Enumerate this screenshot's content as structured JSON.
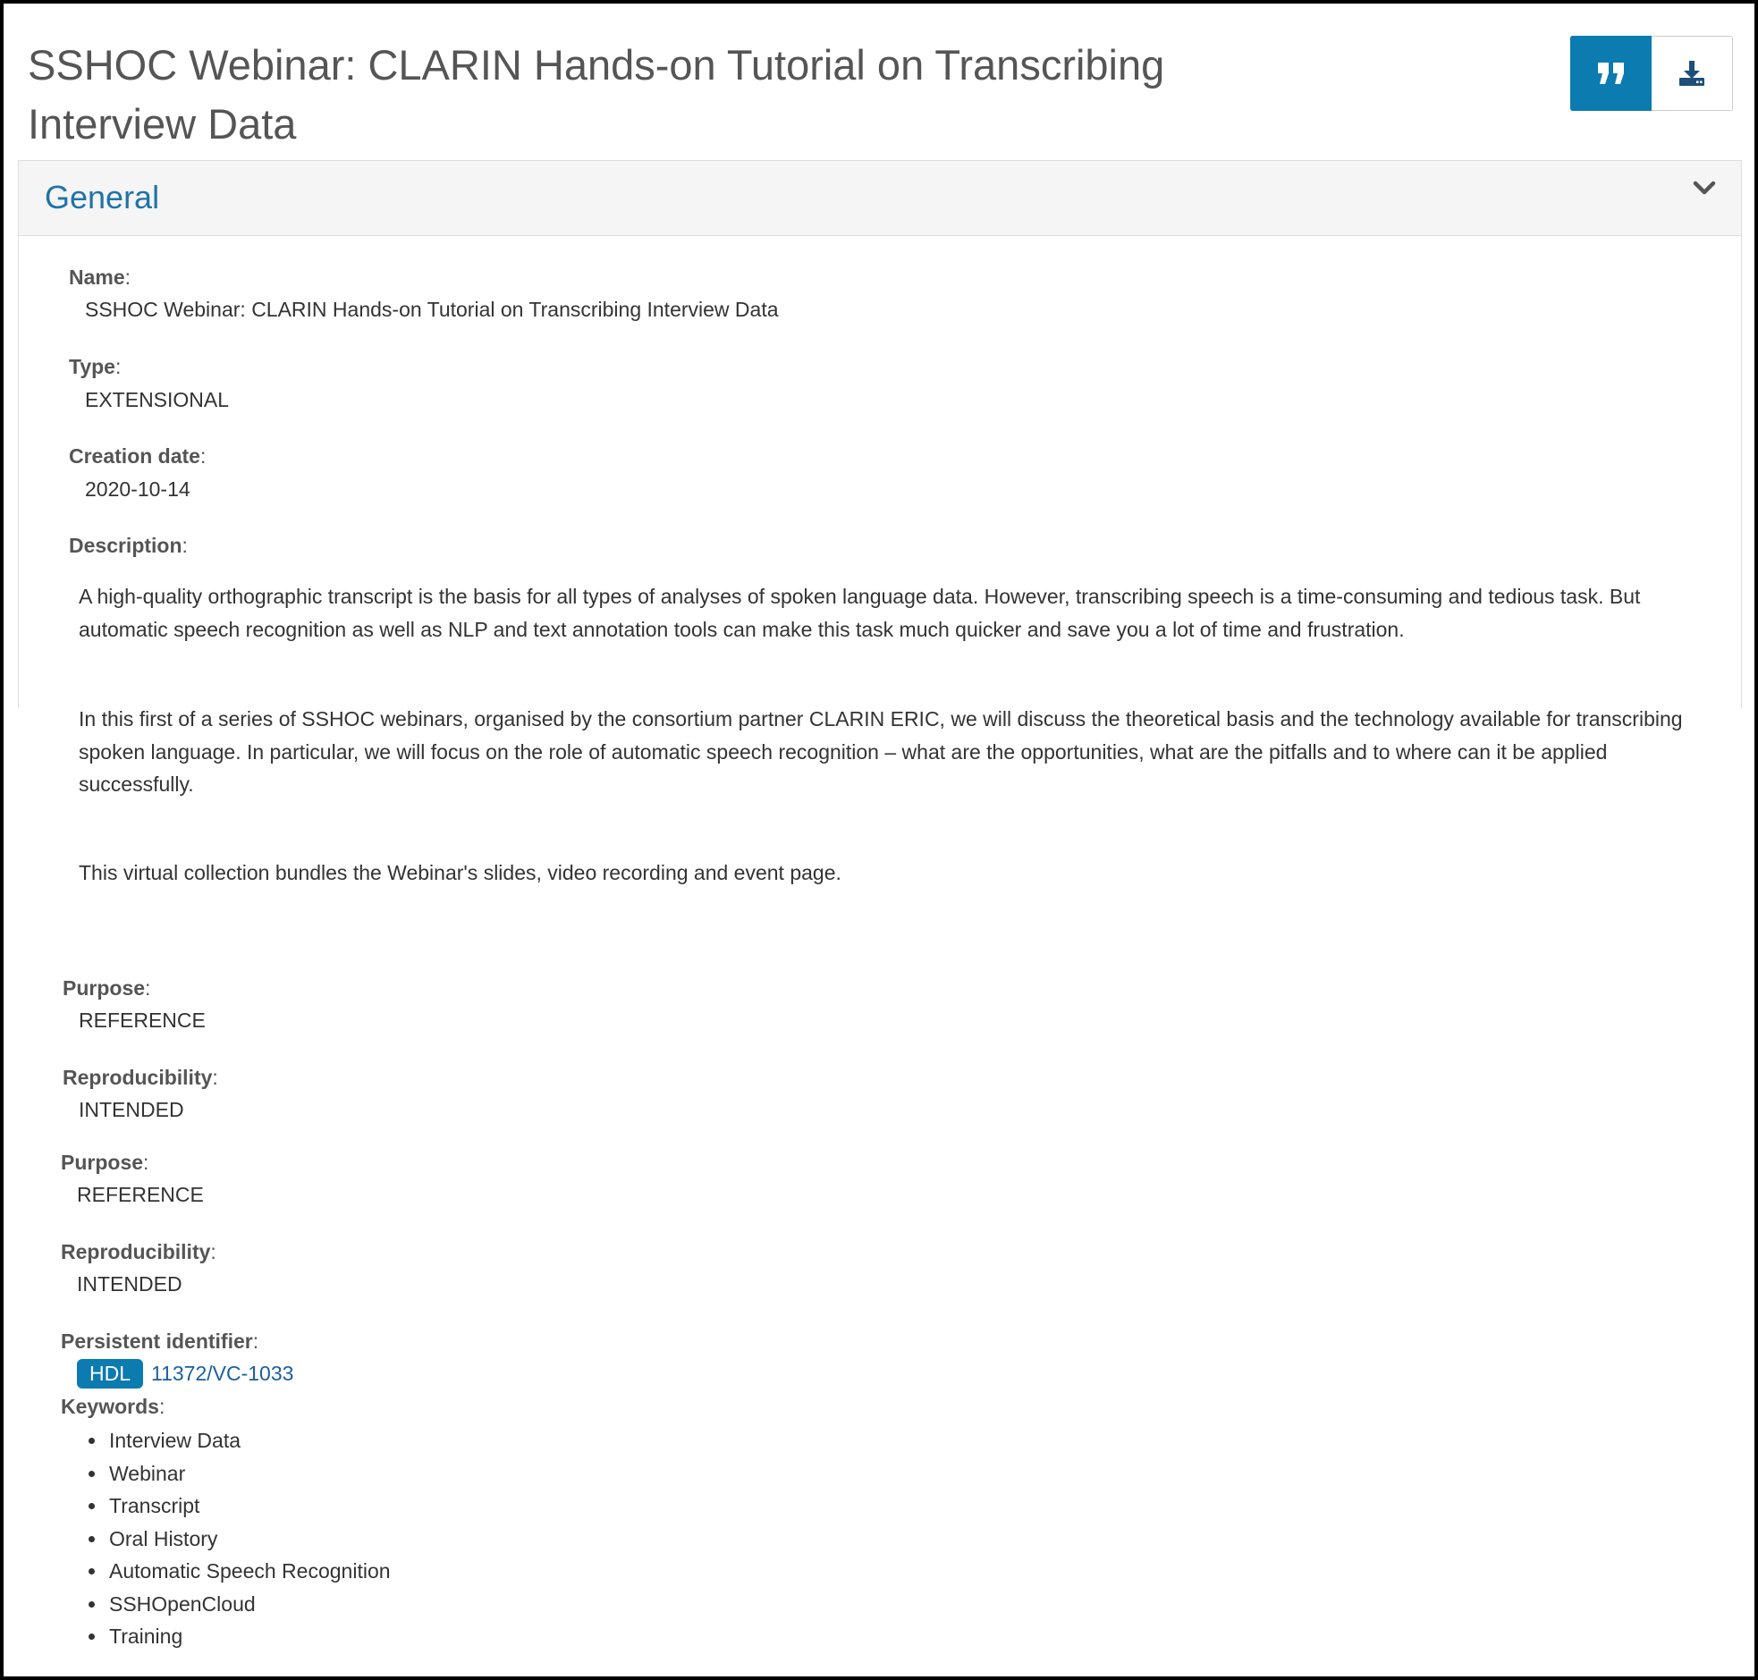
{
  "header": {
    "title": "SSHOC Webinar: CLARIN Hands-on Tutorial on Transcribing Interview Data",
    "actions": {
      "cite_icon": "quote-icon",
      "download_icon": "download-icon",
      "cite_color": "#0b7bb0"
    }
  },
  "panel": {
    "heading": "General",
    "toggle_icon": "chevron-down-icon"
  },
  "fields": {
    "name": {
      "label": "Name",
      "value": "SSHOC Webinar: CLARIN Hands-on Tutorial on Transcribing Interview Data"
    },
    "type": {
      "label": "Type",
      "value": "EXTENSIONAL"
    },
    "creation_date": {
      "label": "Creation date",
      "value": "2020-10-14"
    },
    "description": {
      "label": "Description",
      "paragraphs": [
        "A high-quality orthographic transcript is the basis for all types of analyses of spoken language data. However, transcribing speech is a time-consuming and tedious task. But automatic speech recognition as well as NLP and text annotation tools can make this task much quicker and save you a lot of time and frustration.",
        "In this first of a series of SSHOC webinars, organised by the consortium partner CLARIN ERIC, we will discuss the theoretical basis and the technology available for transcribing spoken language. In particular, we will focus on the role of automatic speech recognition – what are the opportunities, what are the pitfalls and to where can it be applied successfully.",
        "This virtual collection bundles the Webinar's slides, video recording and event page."
      ]
    },
    "purpose_1": {
      "label": "Purpose",
      "value": "REFERENCE"
    },
    "reproducibility_1": {
      "label": "Reproducibility",
      "value": "INTENDED"
    },
    "purpose_2": {
      "label": "Purpose",
      "value": "REFERENCE"
    },
    "reproducibility_2": {
      "label": "Reproducibility",
      "value": "INTENDED"
    },
    "persistent_identifier": {
      "label": "Persistent identifier",
      "badge": "HDL",
      "value": "11372/VC-1033"
    },
    "keywords": {
      "label": "Keywords",
      "items": [
        "Interview Data",
        "Webinar",
        "Transcript",
        "Oral History",
        "Automatic Speech Recognition",
        "SSHOpenCloud",
        "Training"
      ]
    }
  },
  "colors": {
    "accent": "#0b7bb0",
    "heading_link": "#1e73a8",
    "panel_heading_bg": "#f5f5f5"
  }
}
